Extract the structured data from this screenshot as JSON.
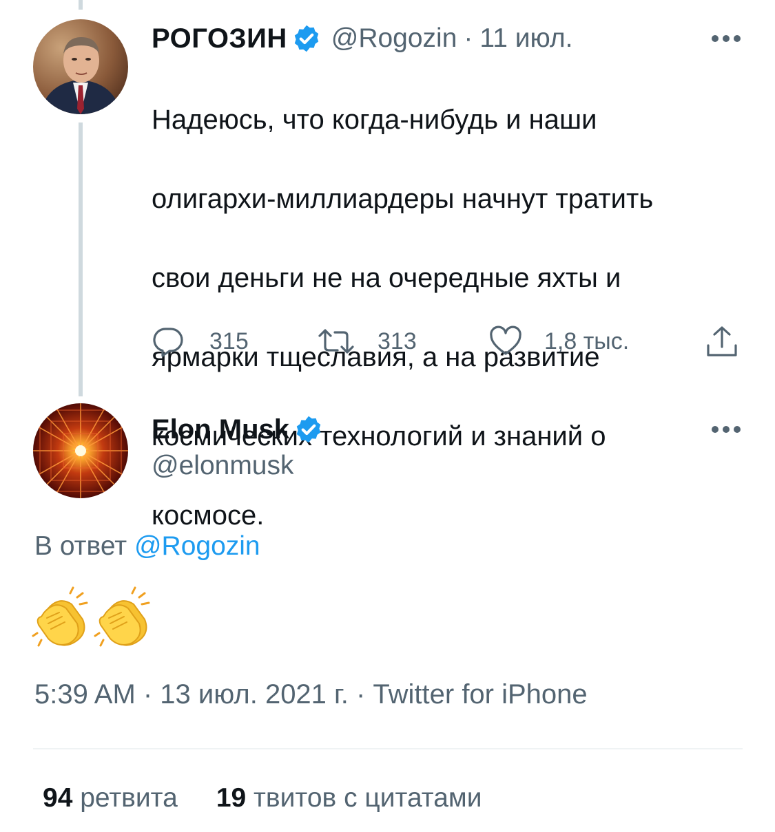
{
  "original_tweet": {
    "display_name": "РОГОЗИН",
    "handle": "@Rogozin",
    "separator": "·",
    "date": "11 июл.",
    "text_lines": [
      "Надеюсь, что когда-нибудь и наши",
      "олигархи-миллиардеры начнут тратить",
      "свои деньги не на очередные яхты и",
      "ярмарки тщеславия, а на развитие",
      "космических технологий и знаний о",
      "космосе."
    ],
    "replies_count": "315",
    "retweets_count": "313",
    "likes_count": "1,8 тыс.",
    "avatar_icon": "portrait-avatar"
  },
  "reply_tweet": {
    "display_name": "Elon Musk",
    "handle": "@elonmusk",
    "reply_prefix": "В ответ",
    "reply_mention": "@Rogozin",
    "emoji": [
      "clapping-hands-emoji",
      "clapping-hands-emoji"
    ],
    "timestamp": "5:39 AM · 13 июл. 2021 г. · Twitter for iPhone",
    "avatar_icon": "starburst-avatar"
  },
  "stats": {
    "retweets_num": "94",
    "retweets_label": "ретвита",
    "quotes_num": "19",
    "quotes_label": "твитов с цитатами"
  },
  "colors": {
    "verified_blue": "#1d9bf0",
    "link_blue": "#1d9bf0",
    "text_primary": "#0f1419",
    "text_secondary": "#536471",
    "thread_line": "#cfd9de"
  }
}
